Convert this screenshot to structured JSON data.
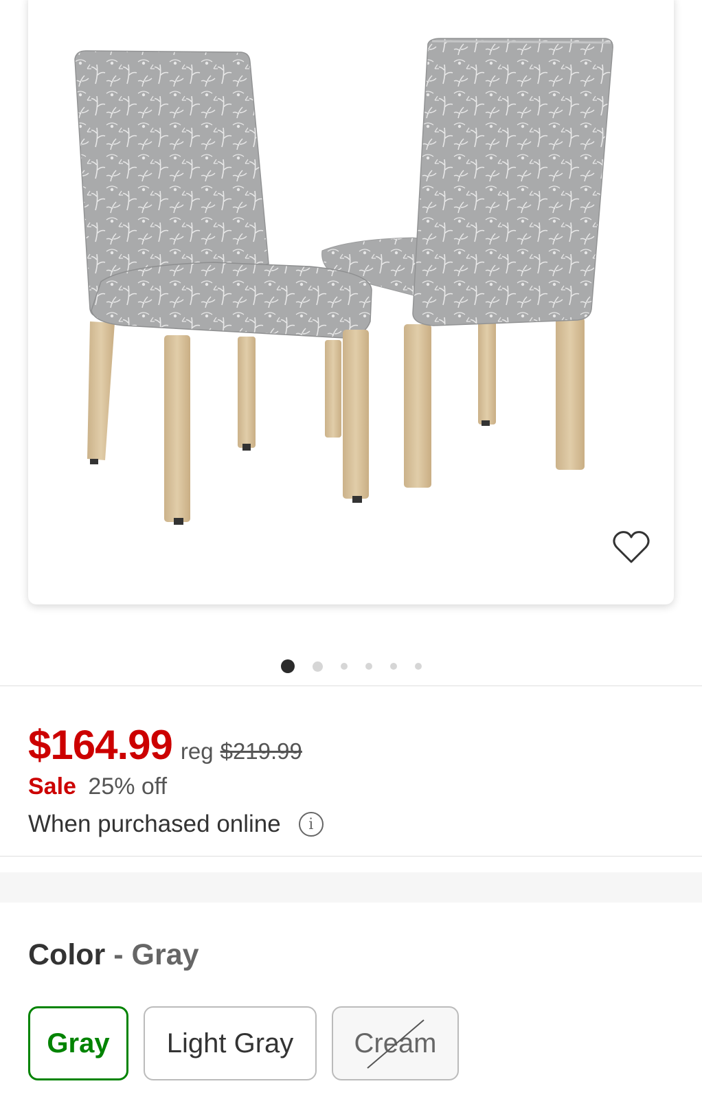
{
  "product": {
    "image_alt": "Gray floral upholstered dining chairs",
    "carousel": {
      "total": 6,
      "active_index": 0
    }
  },
  "pricing": {
    "price": "$164.99",
    "reg_label": "reg",
    "reg_price": "$219.99",
    "sale_label": "Sale",
    "discount": "25% off",
    "online_note": "When purchased online"
  },
  "color": {
    "heading_label": "Color",
    "separator": "-",
    "selected_value": "Gray",
    "options": [
      {
        "label": "Gray",
        "state": "selected"
      },
      {
        "label": "Light Gray",
        "state": "available"
      },
      {
        "label": "Cream",
        "state": "unavailable"
      }
    ]
  },
  "icons": {
    "favorite": "heart-outline-icon",
    "info": "info-circle-icon"
  },
  "colors": {
    "sale_red": "#cc0000",
    "selected_green": "#008300",
    "fabric_gray": "#a9aaab",
    "wood": "#d8c29f"
  }
}
